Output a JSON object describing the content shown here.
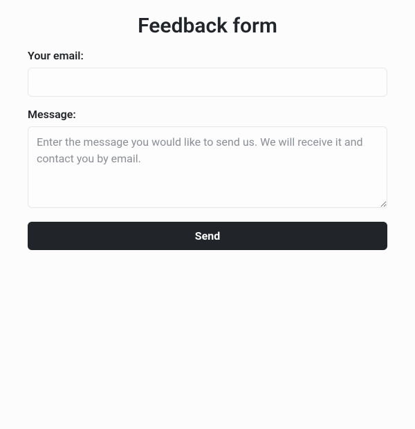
{
  "form": {
    "title": "Feedback form",
    "email_label": "Your email:",
    "email_value": "",
    "message_label": "Message:",
    "message_value": "",
    "message_placeholder": "Enter the message you would like to send us. We will receive it and contact you by email.",
    "submit_label": "Send"
  }
}
